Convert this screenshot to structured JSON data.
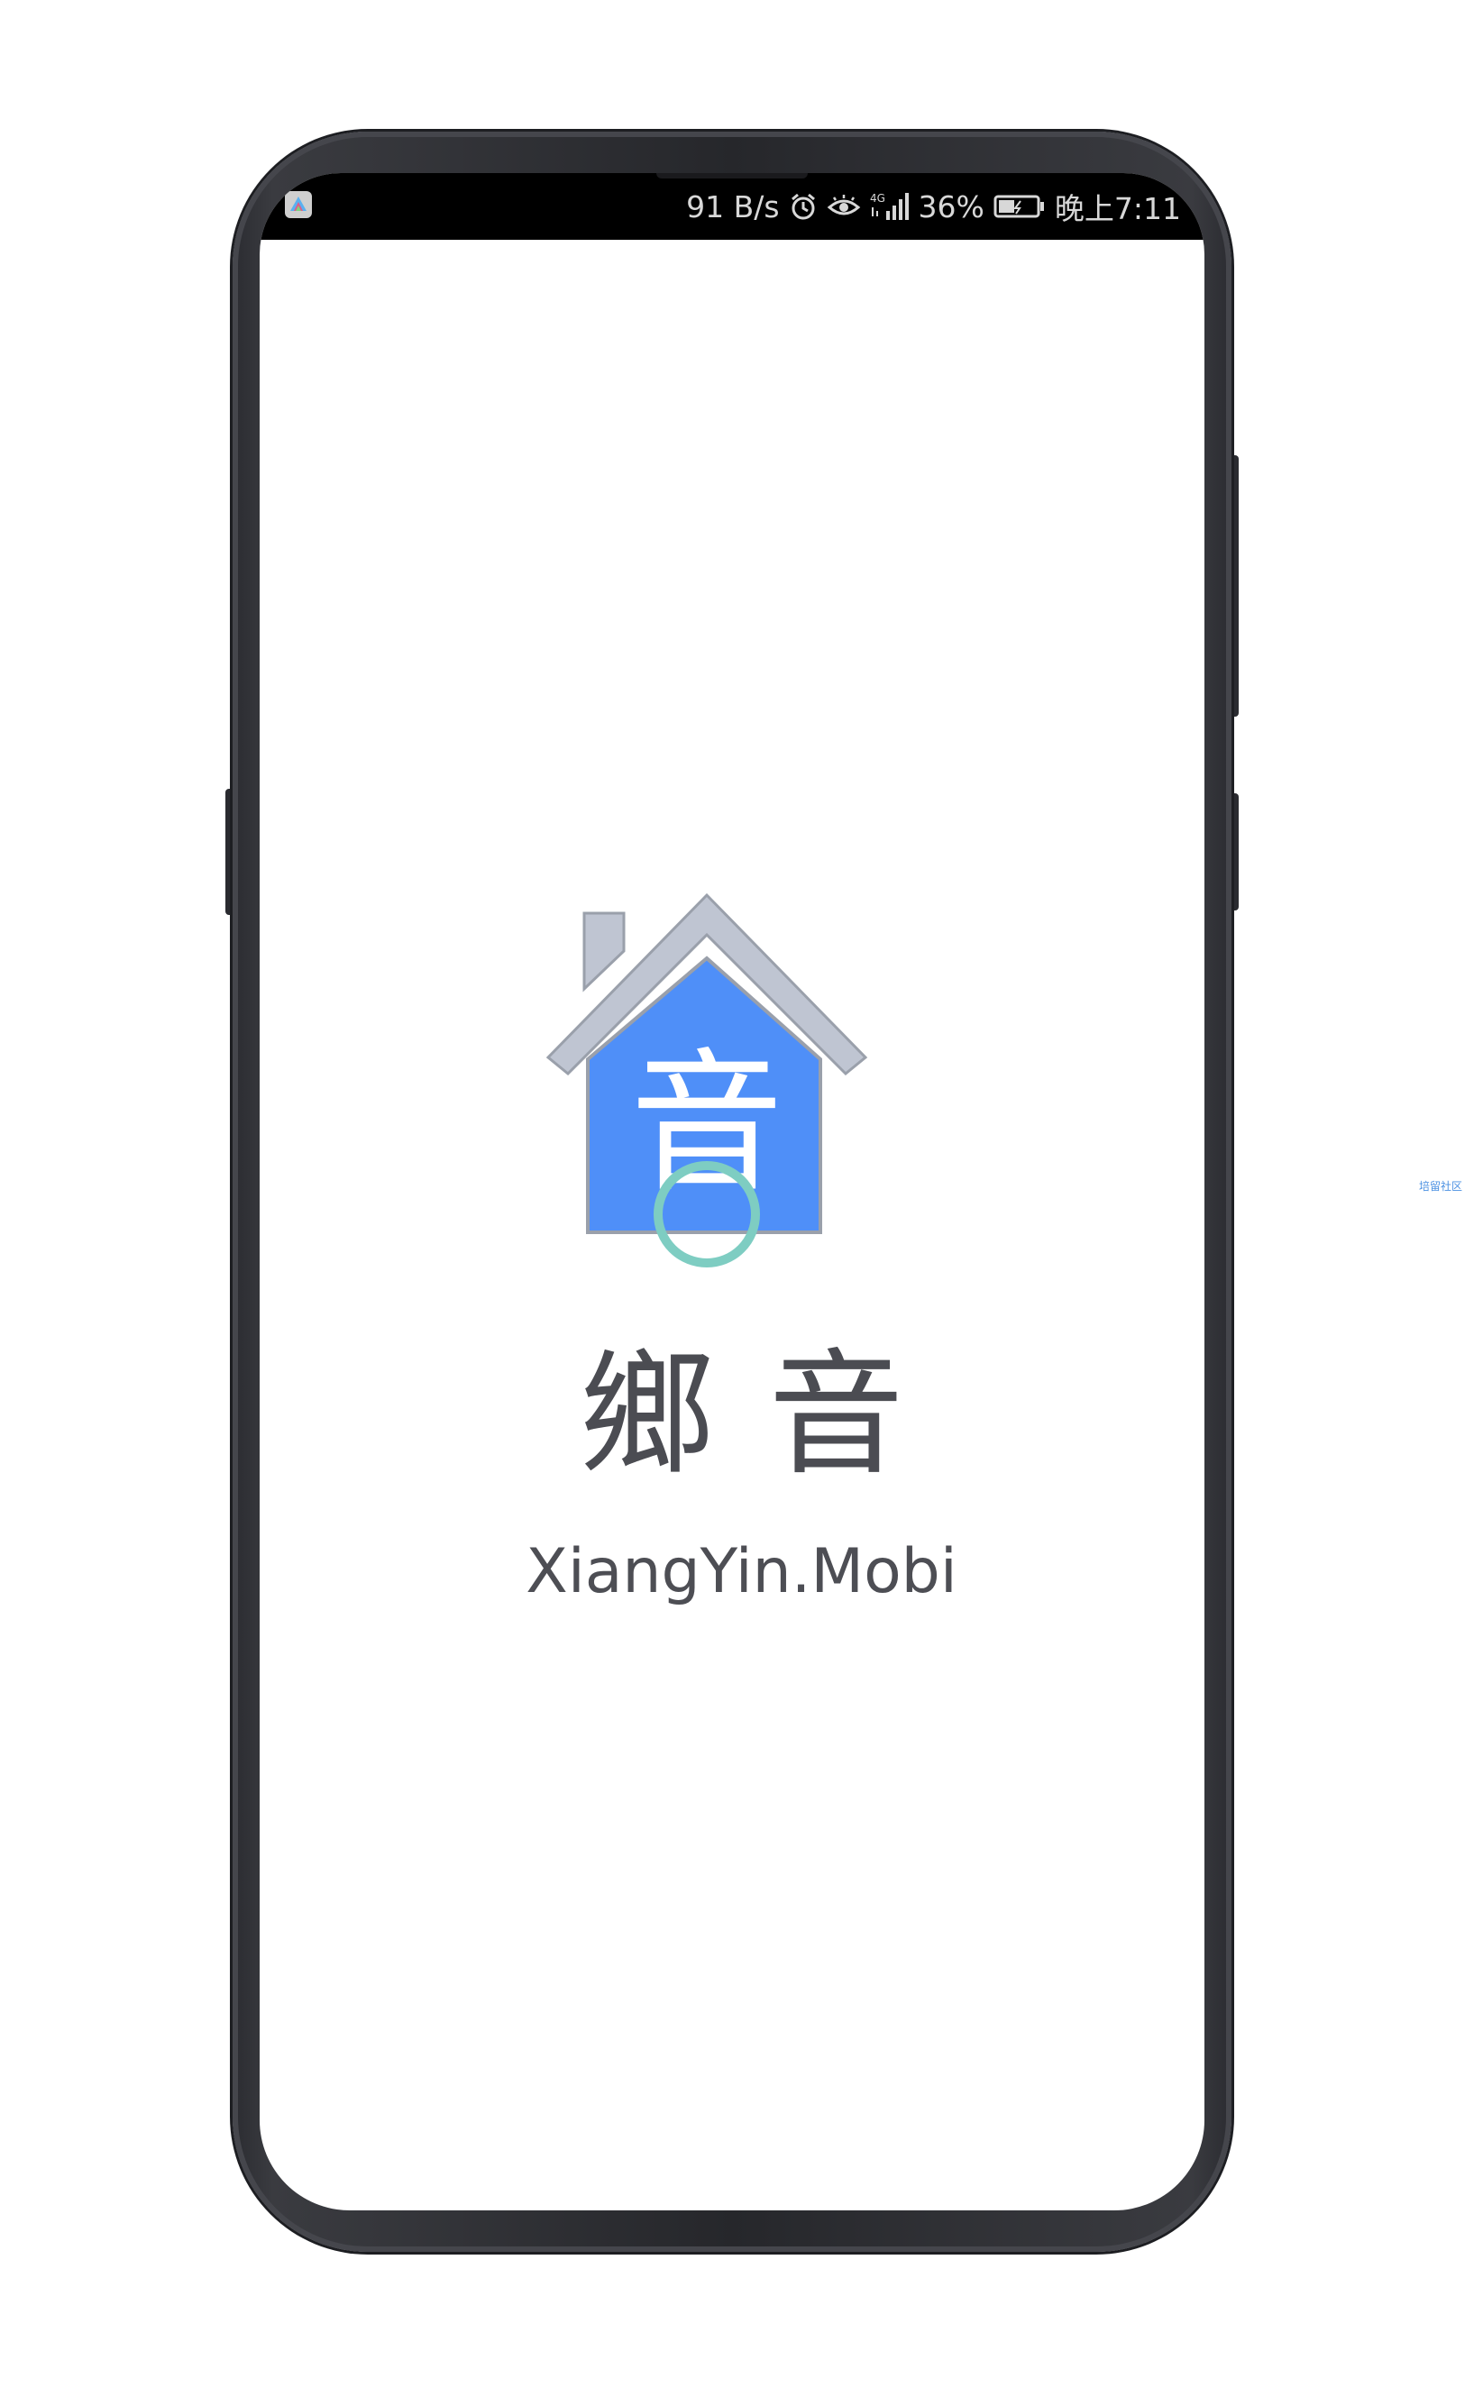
{
  "status_bar": {
    "network_speed": "91 B/s",
    "network_type": "4G",
    "battery": "36%",
    "time": "晚上7:11",
    "icons": [
      "app-notification-icon",
      "alarm-icon",
      "eye-comfort-icon",
      "signal-icon",
      "battery-icon"
    ]
  },
  "splash": {
    "logo_glyph": "音",
    "brand_name_cn": "鄉音",
    "brand_name_en": "XiangYin.Mobi"
  },
  "watermark": {
    "text": "培留社区"
  },
  "colors": {
    "house_blue": "#4f8ff8",
    "roof_gray": "#bfc5d2",
    "ring_teal": "#7ecdc2",
    "text_dark": "#4b4c52",
    "frame": "#2b2c31"
  }
}
